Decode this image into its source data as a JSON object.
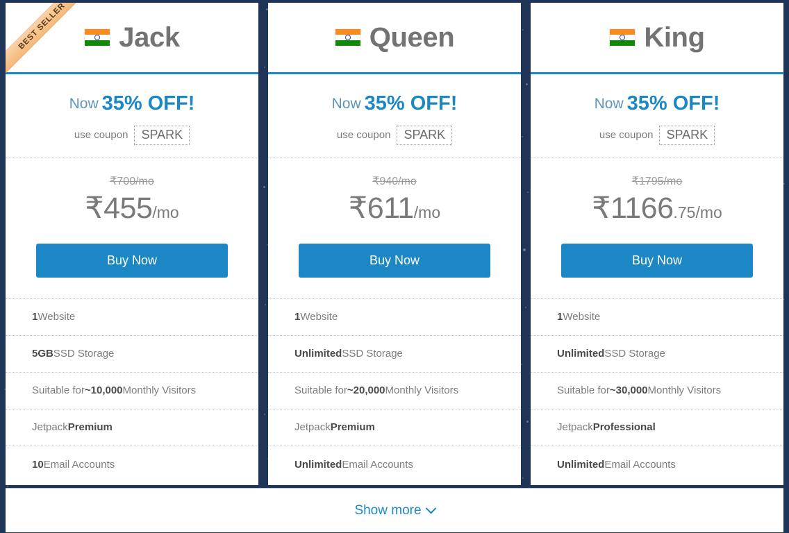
{
  "background": {
    "color": "#1f3557",
    "particle_color": "#8fa6c4"
  },
  "theme": {
    "accent_blue": "#1b87c4",
    "ribbon_bg": "#f5b777",
    "ribbon_text": "#5a3a1a",
    "plan_name_color": "#737373",
    "feature_text_color": "#7d7d7d"
  },
  "plans": [
    {
      "badge": "BEST SELLER",
      "has_badge": true,
      "flag_icon": "india-flag-icon",
      "name": "Jack",
      "promo_now": "Now",
      "promo_off": "35% OFF!",
      "coupon_label": "use coupon",
      "coupon_code": "SPARK",
      "price_old": "₹700/mo",
      "price_main": "₹455",
      "price_cents": "",
      "price_period": "/mo",
      "buy_label": "Buy Now",
      "features": [
        {
          "strong": "1",
          "rest": " Website",
          "lead": ""
        },
        {
          "strong": "5GB",
          "rest": " SSD Storage",
          "lead": ""
        },
        {
          "strong": "~10,000",
          "rest": " Monthly Visitors",
          "lead": "Suitable for "
        },
        {
          "strong": "Premium",
          "rest": "",
          "lead": "Jetpack "
        },
        {
          "strong": "10",
          "rest": " Email Accounts",
          "lead": ""
        }
      ]
    },
    {
      "badge": "",
      "has_badge": false,
      "flag_icon": "india-flag-icon",
      "name": "Queen",
      "promo_now": "Now",
      "promo_off": "35% OFF!",
      "coupon_label": "use coupon",
      "coupon_code": "SPARK",
      "price_old": "₹940/mo",
      "price_main": "₹611",
      "price_cents": "",
      "price_period": "/mo",
      "buy_label": "Buy Now",
      "features": [
        {
          "strong": "1",
          "rest": " Website",
          "lead": ""
        },
        {
          "strong": "Unlimited",
          "rest": " SSD Storage",
          "lead": ""
        },
        {
          "strong": "~20,000",
          "rest": " Monthly Visitors",
          "lead": "Suitable for "
        },
        {
          "strong": "Premium",
          "rest": "",
          "lead": "Jetpack "
        },
        {
          "strong": "Unlimited",
          "rest": " Email Accounts",
          "lead": ""
        }
      ]
    },
    {
      "badge": "",
      "has_badge": false,
      "flag_icon": "india-flag-icon",
      "name": "King",
      "promo_now": "Now",
      "promo_off": "35% OFF!",
      "coupon_label": "use coupon",
      "coupon_code": "SPARK",
      "price_old": "₹1795/mo",
      "price_main": "₹1166",
      "price_cents": ".75",
      "price_period": "/mo",
      "buy_label": "Buy Now",
      "features": [
        {
          "strong": "1",
          "rest": " Website",
          "lead": ""
        },
        {
          "strong": "Unlimited",
          "rest": " SSD Storage",
          "lead": ""
        },
        {
          "strong": "~30,000",
          "rest": " Monthly Visitors",
          "lead": "Suitable for "
        },
        {
          "strong": "Professional",
          "rest": "",
          "lead": "Jetpack "
        },
        {
          "strong": "Unlimited",
          "rest": " Email Accounts",
          "lead": ""
        }
      ]
    }
  ],
  "footer": {
    "show_more_label": "Show more",
    "chevron_icon": "chevron-down-icon"
  }
}
